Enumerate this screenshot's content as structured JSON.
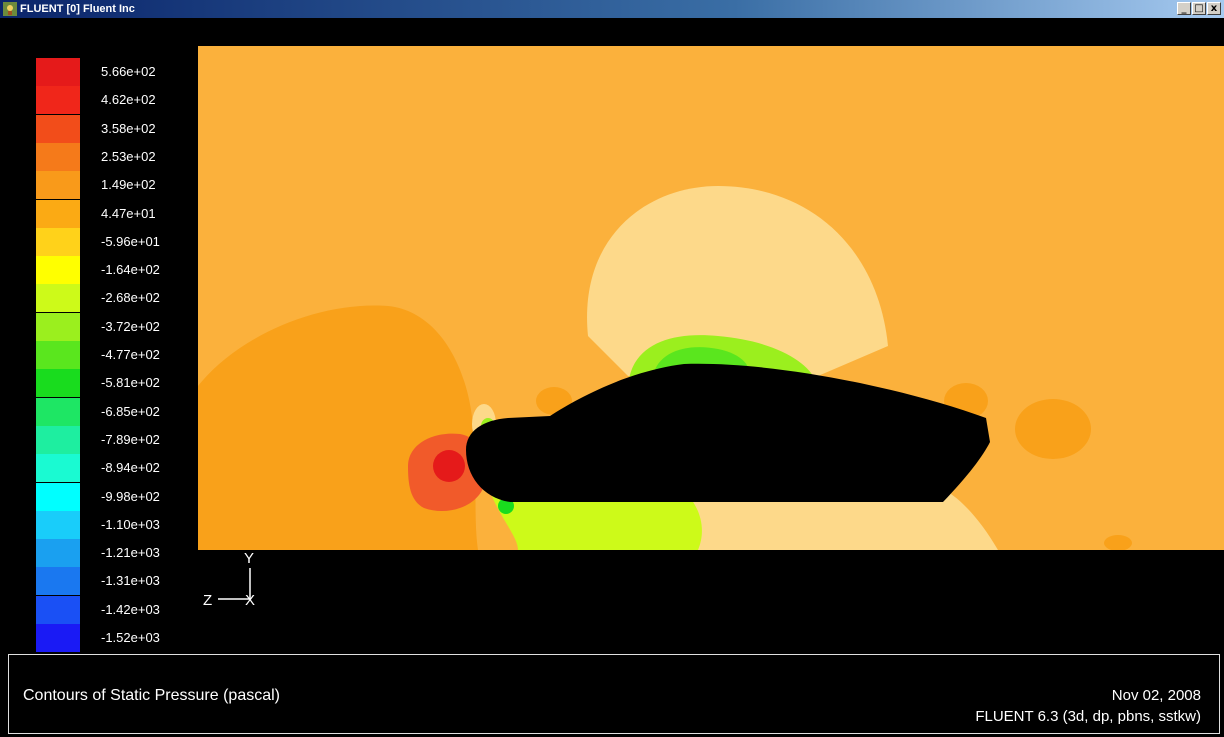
{
  "window": {
    "title": "FLUENT [0] Fluent Inc",
    "buttons": [
      "_",
      "□",
      "x"
    ]
  },
  "legend": {
    "labels": [
      "5.66e+02",
      "4.62e+02",
      "3.58e+02",
      "2.53e+02",
      "1.49e+02",
      "4.47e+01",
      "-5.96e+01",
      "-1.64e+02",
      "-2.68e+02",
      "-3.72e+02",
      "-4.77e+02",
      "-5.81e+02",
      "-6.85e+02",
      "-7.89e+02",
      "-8.94e+02",
      "-9.98e+02",
      "-1.10e+03",
      "-1.21e+03",
      "-1.31e+03",
      "-1.42e+03",
      "-1.52e+03"
    ],
    "colors": [
      "#e51a1a",
      "#f0261a",
      "#f24d1a",
      "#f57a1a",
      "#f99a1a",
      "#fbaa14",
      "#ffd21a",
      "#ffff00",
      "#cdfa19",
      "#9bef1e",
      "#5ae61e",
      "#19dc1e",
      "#1ee664",
      "#1eeea0",
      "#1afad2",
      "#00ffff",
      "#19cdfa",
      "#1aa0f0",
      "#1a78f0",
      "#1a50f5",
      "#1a1af5"
    ]
  },
  "axes": {
    "y": "Y",
    "z": "Z",
    "x": "X"
  },
  "footer": {
    "caption": "Contours of Static Pressure (pascal)",
    "date": "Nov 02, 2008",
    "version": "FLUENT 6.3 (3d, dp, pbns, sstkw)"
  }
}
